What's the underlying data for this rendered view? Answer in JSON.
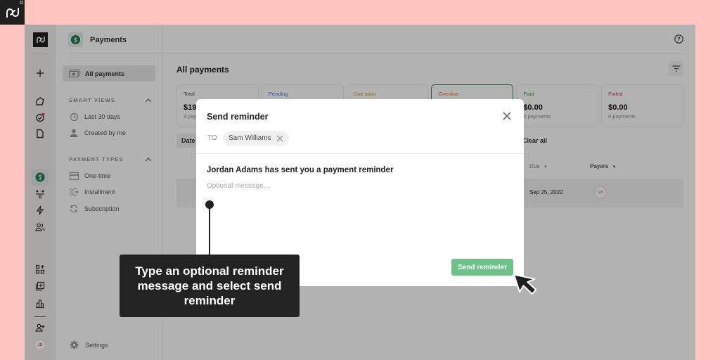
{
  "brand": {
    "logo_text": "pd"
  },
  "rail": {
    "icons": [
      "logo-icon",
      "plus-icon",
      "home-icon",
      "tasks-icon",
      "document-icon",
      "payments-icon",
      "workflow-icon",
      "automation-icon",
      "contacts-icon",
      "add-app-icon",
      "add-content-icon",
      "reports-icon",
      "invite-user-icon"
    ],
    "user_initials": "JD"
  },
  "header": {
    "title": "Payments"
  },
  "sidenav": {
    "all_payments": "All payments",
    "smart_views": {
      "title": "SMART VIEWS",
      "items": [
        {
          "label": "Last 30 days",
          "icon": "history-icon"
        },
        {
          "label": "Created by me",
          "icon": "user-icon"
        }
      ]
    },
    "payment_types": {
      "title": "PAYMENT TYPES",
      "items": [
        {
          "label": "One-time",
          "icon": "card-icon"
        },
        {
          "label": "Installment",
          "icon": "installment-icon"
        },
        {
          "label": "Subscription",
          "icon": "refresh-icon"
        }
      ]
    },
    "settings": "Settings"
  },
  "main": {
    "title": "All payments",
    "cards": [
      {
        "name": "Total",
        "amount": "$19",
        "count": "3 pay",
        "color": "#555555"
      },
      {
        "name": "Pending",
        "amount": "",
        "count": "",
        "color": "#4a7fd6"
      },
      {
        "name": "Due soon",
        "amount": "",
        "count": "",
        "color": "#c9a227"
      },
      {
        "name": "Overdue",
        "amount": "",
        "count": "",
        "color": "#e0773a"
      },
      {
        "name": "Paid",
        "amount": "$0.00",
        "count": "0 payments",
        "color": "#3aa266"
      },
      {
        "name": "Failed",
        "amount": "$0.00",
        "count": "0 payments",
        "color": "#d0436a"
      }
    ],
    "date_filter": "Date",
    "clear_all": "Clear all",
    "columns": {
      "due": "Due",
      "payers": "Payers"
    },
    "rows": [
      {
        "due": "Sep 25, 2022",
        "payer_initials": "SW"
      }
    ]
  },
  "modal": {
    "title": "Send reminder",
    "to_label": "TO",
    "recipient": "Sam Williams",
    "subject": "Jordan Adams has sent you a payment reminder",
    "message_placeholder": "Optional message...",
    "message_value": "",
    "send_label": "Send reminder"
  },
  "callout": {
    "text": "Type an optional reminder message and select send reminder"
  },
  "colors": {
    "background": "#fec6bf",
    "accent_green": "#6cc287",
    "brand_dark": "#1f1f1f",
    "payments_green": "#1f7a4f"
  }
}
